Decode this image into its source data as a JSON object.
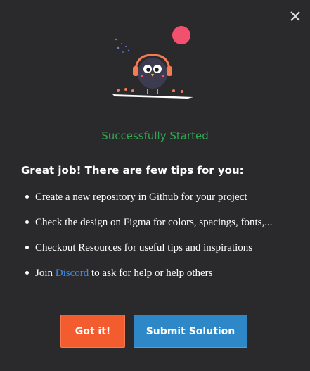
{
  "modal": {
    "close_icon": "close-icon",
    "illustration": "owl-with-headphones-illustration",
    "status_text": "Successfully Started",
    "status_color": "#31a653",
    "heading": "Great job! There are few tips for you:",
    "tips": [
      {
        "text": "Create a new repository in Github for your project"
      },
      {
        "text": "Check the design on Figma for colors, spacings, fonts,..."
      },
      {
        "text": "Checkout Resources for useful tips and inspirations"
      },
      {
        "prefix": "Join ",
        "link": "Discord",
        "suffix": " to ask for help or help others"
      }
    ],
    "buttons": {
      "got_it": "Got it!",
      "submit": "Submit Solution"
    },
    "colors": {
      "background": "#2a2a2c",
      "got_it": "#f35c2e",
      "submit": "#2e88c7",
      "link": "#3d8be8"
    }
  }
}
